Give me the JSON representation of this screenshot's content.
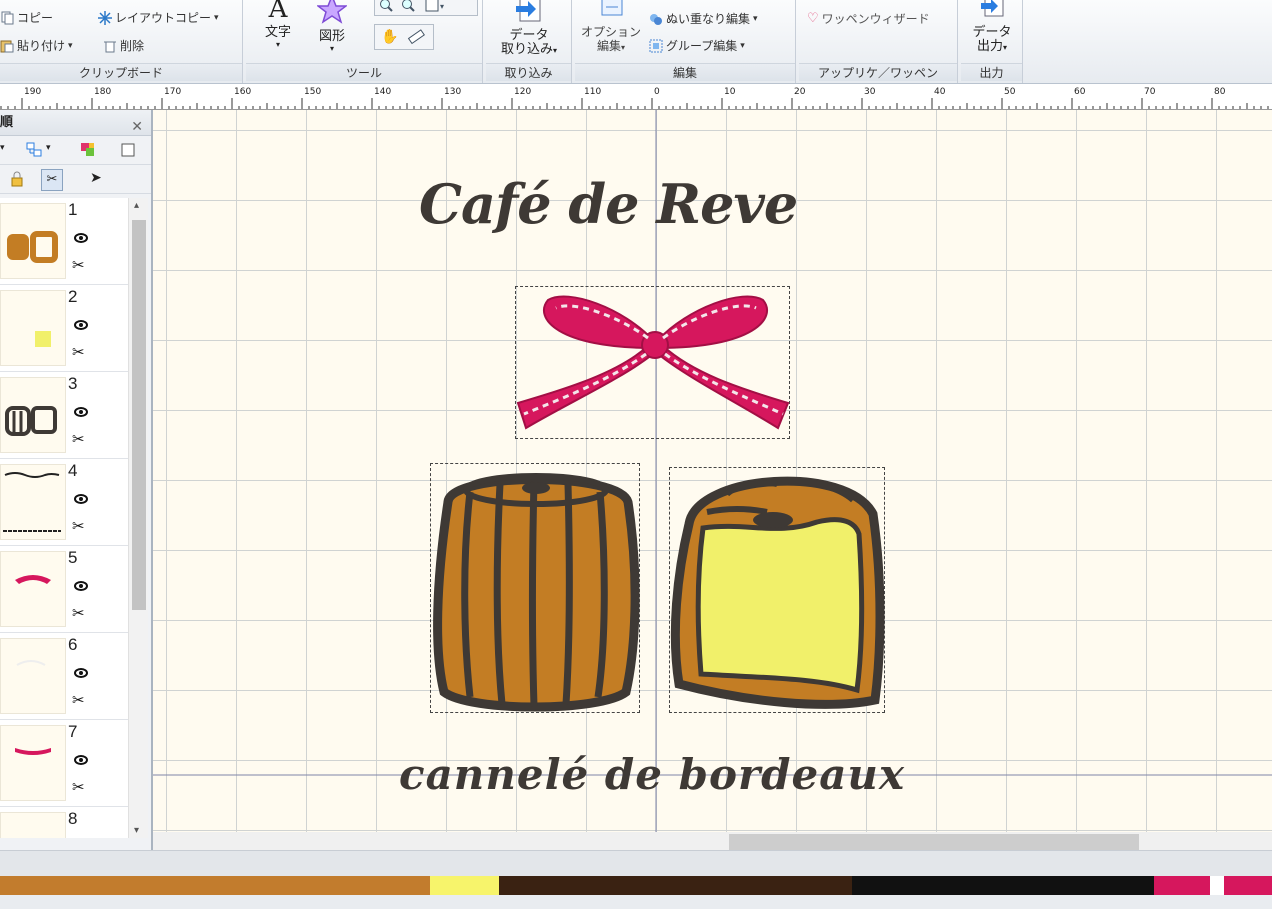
{
  "ribbon": {
    "clipboard": {
      "copy": "コピー",
      "layout_copy": "レイアウトコピー",
      "paste": "貼り付け",
      "delete": "削除",
      "label": "クリップボード"
    },
    "tools": {
      "text": "文字",
      "shape": "図形",
      "label": "ツール"
    },
    "import": {
      "data_import_line1": "データ",
      "data_import_line2": "取り込み",
      "label": "取り込み"
    },
    "edit": {
      "option_line1": "オプション",
      "option_line2": "編集",
      "overlap_edit": "ぬい重なり編集",
      "group_edit": "グループ編集",
      "label": "編集"
    },
    "applique": {
      "wappen_wizard": "ワッペンウィザード",
      "label": "アップリケ／ワッペン"
    },
    "output": {
      "data_output_line1": "データ",
      "data_output_line2": "出力",
      "label": "出力"
    }
  },
  "ruler": {
    "labels": [
      "190",
      "180",
      "170",
      "160",
      "150",
      "140",
      "130",
      "120",
      "110",
      "0",
      "10",
      "20",
      "30",
      "40",
      "50",
      "60",
      "70",
      "80"
    ]
  },
  "panel": {
    "title": "順",
    "items": [
      {
        "number": "1"
      },
      {
        "number": "2"
      },
      {
        "number": "3"
      },
      {
        "number": "4"
      },
      {
        "number": "5"
      },
      {
        "number": "6"
      },
      {
        "number": "7"
      },
      {
        "number": "8"
      }
    ]
  },
  "canvas": {
    "title_text": "Café de Reve",
    "subtitle_text": "cannelé de bordeaux"
  },
  "colors": {
    "background": "#fffbf0",
    "grid": "#d0d3d2",
    "caramel": "#c37d24",
    "dark_brown": "#3e3935",
    "cream": "#f1f06a",
    "pink": "#d6175d"
  },
  "thread_colors": [
    "#c27c2d",
    "#f7f46b",
    "#3a2212",
    "#111111",
    "#d6175d",
    "#ffffff",
    "#d6175d"
  ],
  "thread_ratios": [
    0.338,
    0.054,
    0.278,
    0.237,
    0.044,
    0.011,
    0.038
  ]
}
